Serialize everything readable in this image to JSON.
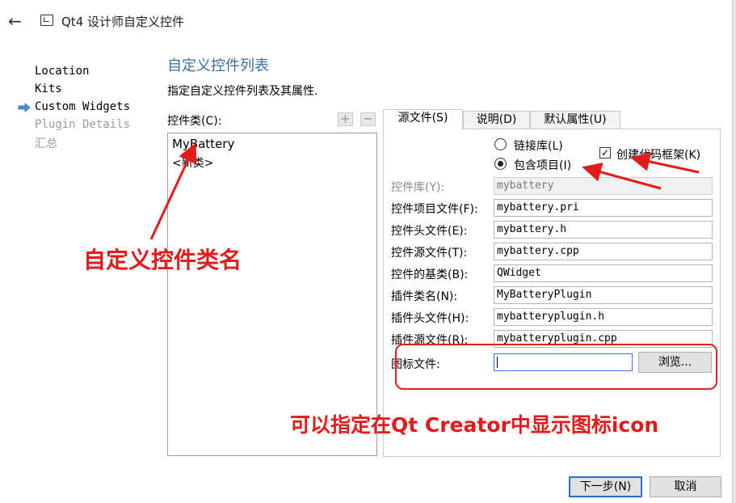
{
  "window": {
    "title": "Qt4 设计师自定义控件"
  },
  "nav": {
    "items": [
      {
        "label": "Location",
        "state": "done"
      },
      {
        "label": "Kits",
        "state": "done"
      },
      {
        "label": "Custom Widgets",
        "state": "current"
      },
      {
        "label": "Plugin Details",
        "state": "pending"
      },
      {
        "label": "汇总",
        "state": "pending"
      }
    ]
  },
  "page": {
    "title": "自定义控件列表",
    "subtitle": "指定自定义控件列表及其属性."
  },
  "class_list": {
    "label": "控件类(C):",
    "items": [
      "MyBattery",
      "<新类>"
    ]
  },
  "tabs": [
    {
      "label": "源文件(S)",
      "active": true
    },
    {
      "label": "说明(D)",
      "active": false
    },
    {
      "label": "默认属性(U)",
      "active": false
    }
  ],
  "options": {
    "link_library": {
      "label": "链接库(L)",
      "selected": false
    },
    "include_project": {
      "label": "包含项目(I)",
      "selected": true
    },
    "create_skeleton": {
      "label": "创建代码框架(K)",
      "checked": true
    }
  },
  "form": {
    "fields": [
      {
        "label": "控件库(Y):",
        "value": "mybattery",
        "disabled": true
      },
      {
        "label": "控件项目文件(F):",
        "value": "mybattery.pri",
        "disabled": false
      },
      {
        "label": "控件头文件(E):",
        "value": "mybattery.h",
        "disabled": false
      },
      {
        "label": "控件源文件(T):",
        "value": "mybattery.cpp",
        "disabled": false
      },
      {
        "label": "控件的基类(B):",
        "value": "QWidget",
        "disabled": false
      },
      {
        "label": "插件类名(N):",
        "value": "MyBatteryPlugin",
        "disabled": false
      },
      {
        "label": "插件头文件(H):",
        "value": "mybatteryplugin.h",
        "disabled": false
      },
      {
        "label": "插件源文件(R):",
        "value": "mybatteryplugin.cpp",
        "disabled": false
      }
    ],
    "icon_file": {
      "label": "图标文件:",
      "value": "",
      "browse_label": "浏览..."
    }
  },
  "annotations": {
    "class_name_note": "自定义控件类名",
    "icon_note": "可以指定在Qt Creator中显示图标icon",
    "color": "#e51a1a"
  },
  "footer": {
    "next_label": "下一步(N)",
    "cancel_label": "取消"
  },
  "colors": {
    "accent": "#3a6ea8",
    "nav_arrow": "#4a90d9",
    "focus": "#2a6fd0"
  }
}
